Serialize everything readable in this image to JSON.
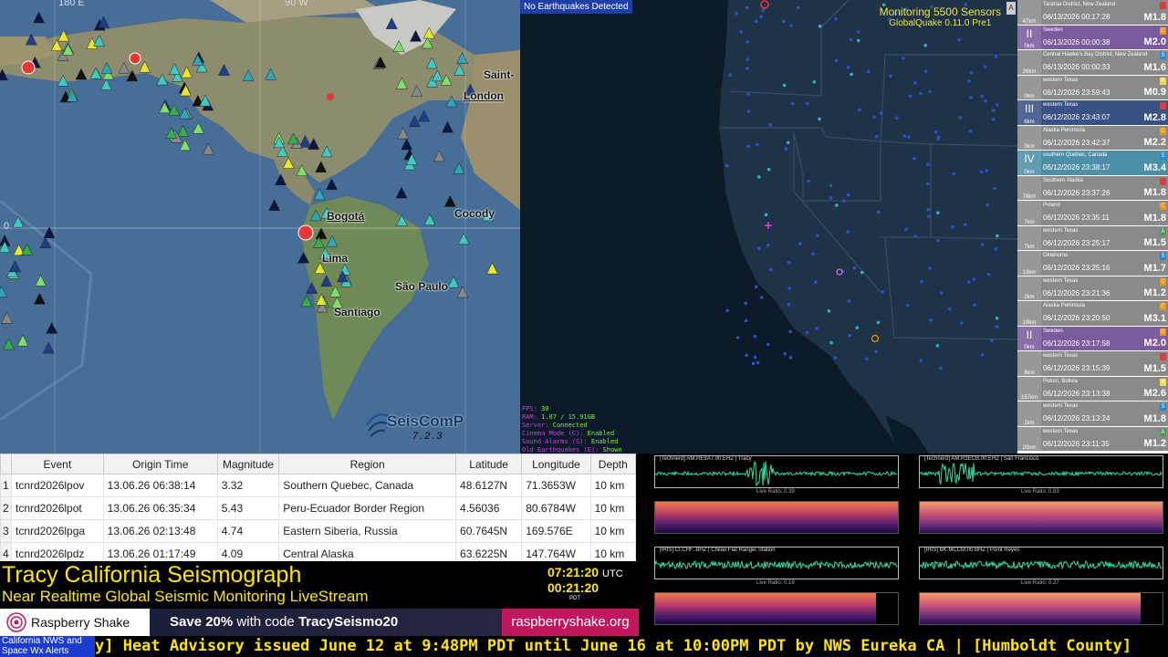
{
  "seiscomp_map": {
    "grid_labels": [
      "180 E",
      "90 W",
      "0"
    ],
    "cities": [
      "London",
      "Bogotá",
      "Cocody",
      "Lima",
      "São Paulo",
      "Santiago",
      "Saint-"
    ],
    "logo_text": "SeisComP",
    "logo_version": "7.2.3"
  },
  "gq_map": {
    "status_badge": "No Earthquakes Detected",
    "monitor_line1": "Monitoring 5500 Sensors",
    "monitor_line2": "GlobalQuake 0.11.0 Pre1",
    "scroll_button": "A",
    "stats": [
      {
        "k": "FPS:",
        "v": "30"
      },
      {
        "k": "RAM:",
        "v": "1.07 / 15.91GB"
      },
      {
        "k": "Server:",
        "v": "Connected"
      },
      {
        "k": "Cinema Mode (C):",
        "v": "Enabled"
      },
      {
        "k": "Sound Alarms (S):",
        "v": "Enabled"
      },
      {
        "k": "Old Earthquakes (E):",
        "v": "Shown"
      }
    ]
  },
  "quake_list": [
    {
      "intensity": "",
      "dist": "47km",
      "region": "Tararua District, New Zealand",
      "time": "06/13/2026 00:17:28",
      "mag": "M1.8",
      "color": "#8a8a8a",
      "dot": "",
      "dot_color": "#e53935"
    },
    {
      "intensity": "II",
      "dist": "0km",
      "region": "Sweden",
      "time": "06/13/2026 00:00:38",
      "mag": "M2.0",
      "color": "#7a5c9e",
      "dot": "C",
      "dot_color": "#ff8f00"
    },
    {
      "intensity": "",
      "dist": "26km",
      "region": "Central Hawke's Bay District, New Zealand",
      "time": "06/13/2026 00:00:33",
      "mag": "M1.6",
      "color": "#8a8a8a",
      "dot": "S",
      "dot_color": "#1e88e5"
    },
    {
      "intensity": "",
      "dist": "0km",
      "region": "western Texas",
      "time": "06/12/2026 23:59:43",
      "mag": "M0.9",
      "color": "#8a8a8a",
      "dot": "B",
      "dot_color": "#fdd835"
    },
    {
      "intensity": "III",
      "dist": "6km",
      "region": "western Texas",
      "time": "06/12/2026 23:43:07",
      "mag": "M2.8",
      "color": "#3b5186",
      "dot": "",
      "dot_color": "#e53935"
    },
    {
      "intensity": "",
      "dist": "0km",
      "region": "Alaska Peninsula",
      "time": "06/12/2026 23:42:37",
      "mag": "M2.2",
      "color": "#8a8a8a",
      "dot": "C",
      "dot_color": "#ff8f00"
    },
    {
      "intensity": "IV",
      "dist": "0km",
      "region": "southern Quebec, Canada",
      "time": "06/12/2026 23:38:17",
      "mag": "M3.4",
      "color": "#4d8fa6",
      "dot": "S",
      "dot_color": "#1e88e5"
    },
    {
      "intensity": "",
      "dist": "78km",
      "region": "Southern Alaska",
      "time": "06/12/2026 23:37:26",
      "mag": "M1.8",
      "color": "#8a8a8a",
      "dot": "",
      "dot_color": "#e53935"
    },
    {
      "intensity": "",
      "dist": "7km",
      "region": "Poland",
      "time": "06/12/2026 23:35:11",
      "mag": "M1.8",
      "color": "#8a8a8a",
      "dot": "C",
      "dot_color": "#ff8f00"
    },
    {
      "intensity": "",
      "dist": "7km",
      "region": "western Texas",
      "time": "06/12/2026 23:25:17",
      "mag": "M1.5",
      "color": "#8a8a8a",
      "dot": "A",
      "dot_color": "#43a047"
    },
    {
      "intensity": "",
      "dist": "13km",
      "region": "Oklahoma",
      "time": "06/12/2026 23:25:16",
      "mag": "M1.7",
      "color": "#8a8a8a",
      "dot": "S",
      "dot_color": "#1e88e5"
    },
    {
      "intensity": "",
      "dist": "2km",
      "region": "western Texas",
      "time": "06/12/2026 23:21:36",
      "mag": "M1.2",
      "color": "#8a8a8a",
      "dot": "C",
      "dot_color": "#ff8f00"
    },
    {
      "intensity": "",
      "dist": "18km",
      "region": "Alaska Peninsula",
      "time": "06/12/2026 23:20:50",
      "mag": "M3.1",
      "color": "#8a8a8a",
      "dot": "C",
      "dot_color": "#ff8f00"
    },
    {
      "intensity": "II",
      "dist": "0km",
      "region": "Sweden",
      "time": "06/12/2026 23:17:58",
      "mag": "M2.0",
      "color": "#7a5c9e",
      "dot": "C",
      "dot_color": "#ff8f00"
    },
    {
      "intensity": "",
      "dist": "8km",
      "region": "western Texas",
      "time": "06/12/2026 23:15:39",
      "mag": "M1.5",
      "color": "#8a8a8a",
      "dot": "",
      "dot_color": "#e53935"
    },
    {
      "intensity": "",
      "dist": "157km",
      "region": "Potosí, Bolivia",
      "time": "06/12/2026 23:13:38",
      "mag": "M2.6",
      "color": "#8a8a8a",
      "dot": "B",
      "dot_color": "#fdd835"
    },
    {
      "intensity": "",
      "dist": "2km",
      "region": "western Texas",
      "time": "06/12/2026 23:13:24",
      "mag": "M1.8",
      "color": "#8a8a8a",
      "dot": "S",
      "dot_color": "#1e88e5"
    },
    {
      "intensity": "",
      "dist": "20km",
      "region": "western Texas",
      "time": "06/12/2026 23:11:35",
      "mag": "M1.2",
      "color": "#8a8a8a",
      "dot": "A",
      "dot_color": "#43a047"
    }
  ],
  "event_table": {
    "headers": [
      "",
      "Event",
      "Origin Time",
      "Magnitude",
      "Region",
      "Latitude",
      "Longitude",
      "Depth"
    ],
    "rows": [
      [
        "1",
        "tcnrd2026lpov",
        "13.06.26 06:38:14",
        "3.32",
        "Southern Quebec, Canada",
        "48.6127N",
        "71.3653W",
        "10 km"
      ],
      [
        "2",
        "tcnrd2026lpot",
        "13.06.26 06:35:34",
        "5.43",
        "Peru-Ecuador Border Region",
        "4.56036",
        "80.6784W",
        "10 km"
      ],
      [
        "3",
        "tcnrd2026lpga",
        "13.06.26 02:13:48",
        "4.74",
        "Eastern Siberia, Russia",
        "60.7645N",
        "169.576E",
        "10 km"
      ],
      [
        "4",
        "tcnrd2026lpdz",
        "13.06.26 01:17:49",
        "4.09",
        "Central Alaska",
        "63.6225N",
        "147.764W",
        "10 km"
      ]
    ]
  },
  "seismograms": [
    {
      "title": "[Technerd] AM.RE9A7.00.EHZ | Tracy",
      "ratio": "Live Ratio: 0.39"
    },
    {
      "title": "[Technerd] AM.R3ECB.00.EHZ | San Francisco",
      "ratio": "Live Ratio: 0.83"
    },
    {
      "title": "[IRIS] CI.CHF..BHZ | Chilao Flat Ranger Station",
      "ratio": "Live Ratio: 0.19"
    },
    {
      "title": "[IRIS] BK.MCCM.00.BHZ | Point Reyes",
      "ratio": "Live Ratio: 0.27"
    }
  ],
  "title_bar": {
    "main": "Tracy California Seismograph",
    "sub": "Near Realtime Global Seismic Monitoring LiveStream",
    "clock_utc": "07:21:20",
    "clock_utc_tz": "UTC",
    "clock_pdt": "00:21:20",
    "clock_pdt_tz": "PDT"
  },
  "promo": {
    "logo_text": "Raspberry Shake",
    "offer_prefix": "Save 20%",
    "offer_middle": " with code ",
    "offer_code": "TracySeismo20",
    "url": "raspberryshake.org"
  },
  "ticker": {
    "label_line1": "California NWS  and",
    "label_line2": "Space Wx Alerts",
    "text": "y] Heat Advisory issued June 12 at 9:48PM PDT until June 16 at 10:00PM PDT by NWS Eureka CA  |  [Humboldt County]"
  }
}
